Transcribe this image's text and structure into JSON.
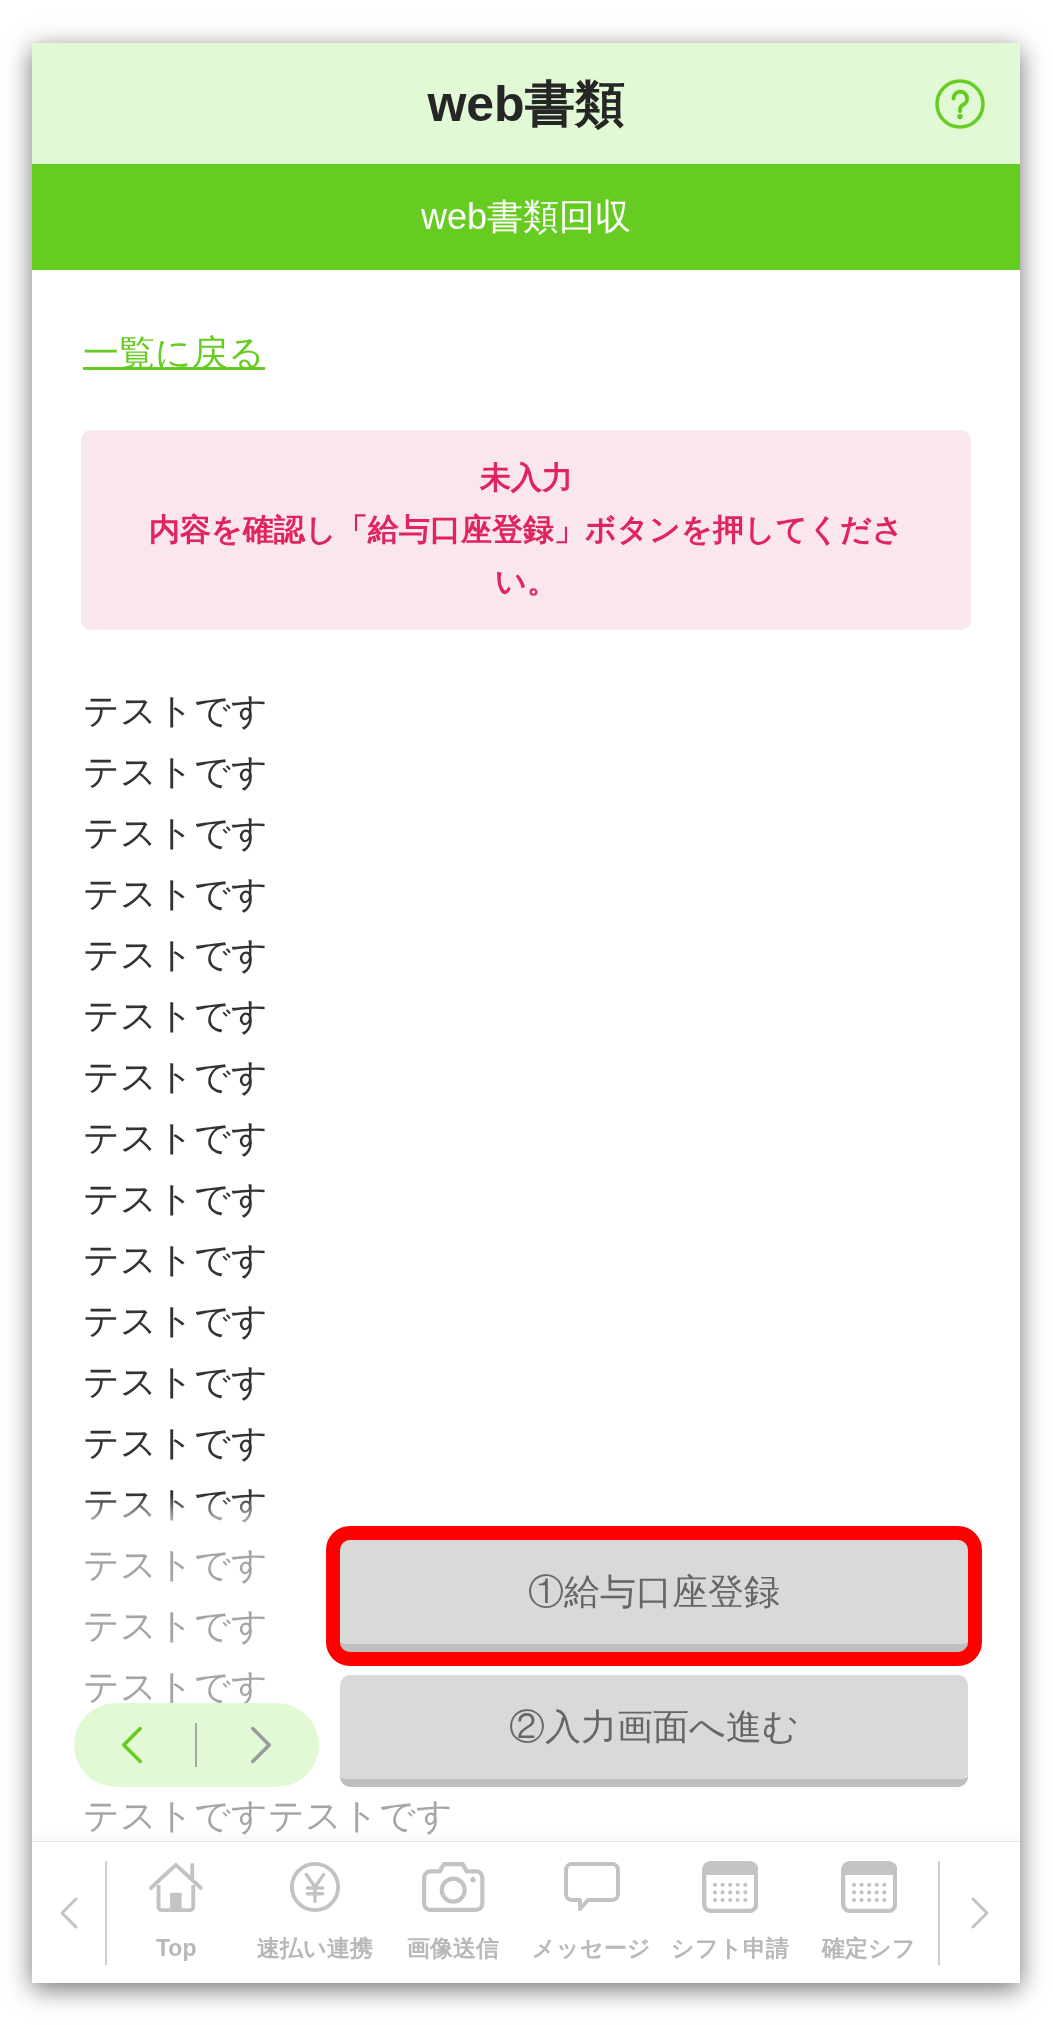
{
  "header": {
    "title": "web書類"
  },
  "subheader": {
    "title": "web書類回収"
  },
  "back_link": "一覧に戻る",
  "alert": {
    "title": "未入力",
    "message": "内容を確認し「給与口座登録」ボタンを押してください。"
  },
  "lines": [
    "テストです",
    "テストです",
    "テストです",
    "テストです",
    "テストです",
    "テストです",
    "テストです",
    "テストです",
    "テストです",
    "テストです",
    "テストです",
    "テストです",
    "テストです",
    "テストです",
    "テストです",
    "テストです",
    "テストです",
    "テストですテストです"
  ],
  "pager": [
    {
      "kind": "prev",
      "disabled": false
    },
    {
      "kind": "next",
      "disabled": true
    }
  ],
  "actions": [
    {
      "label": "①給与口座登録",
      "highlighted": true
    },
    {
      "label": "②入力画面へ進む",
      "highlighted": false
    }
  ],
  "nav": {
    "items": [
      {
        "kind": "home",
        "label": "Top"
      },
      {
        "kind": "yen",
        "label": "速払い連携"
      },
      {
        "kind": "camera",
        "label": "画像送信"
      },
      {
        "kind": "chat",
        "label": "メッセージ"
      },
      {
        "kind": "calendar",
        "label": "シフト申請"
      },
      {
        "kind": "calendar",
        "label": "確定シフ"
      }
    ]
  }
}
